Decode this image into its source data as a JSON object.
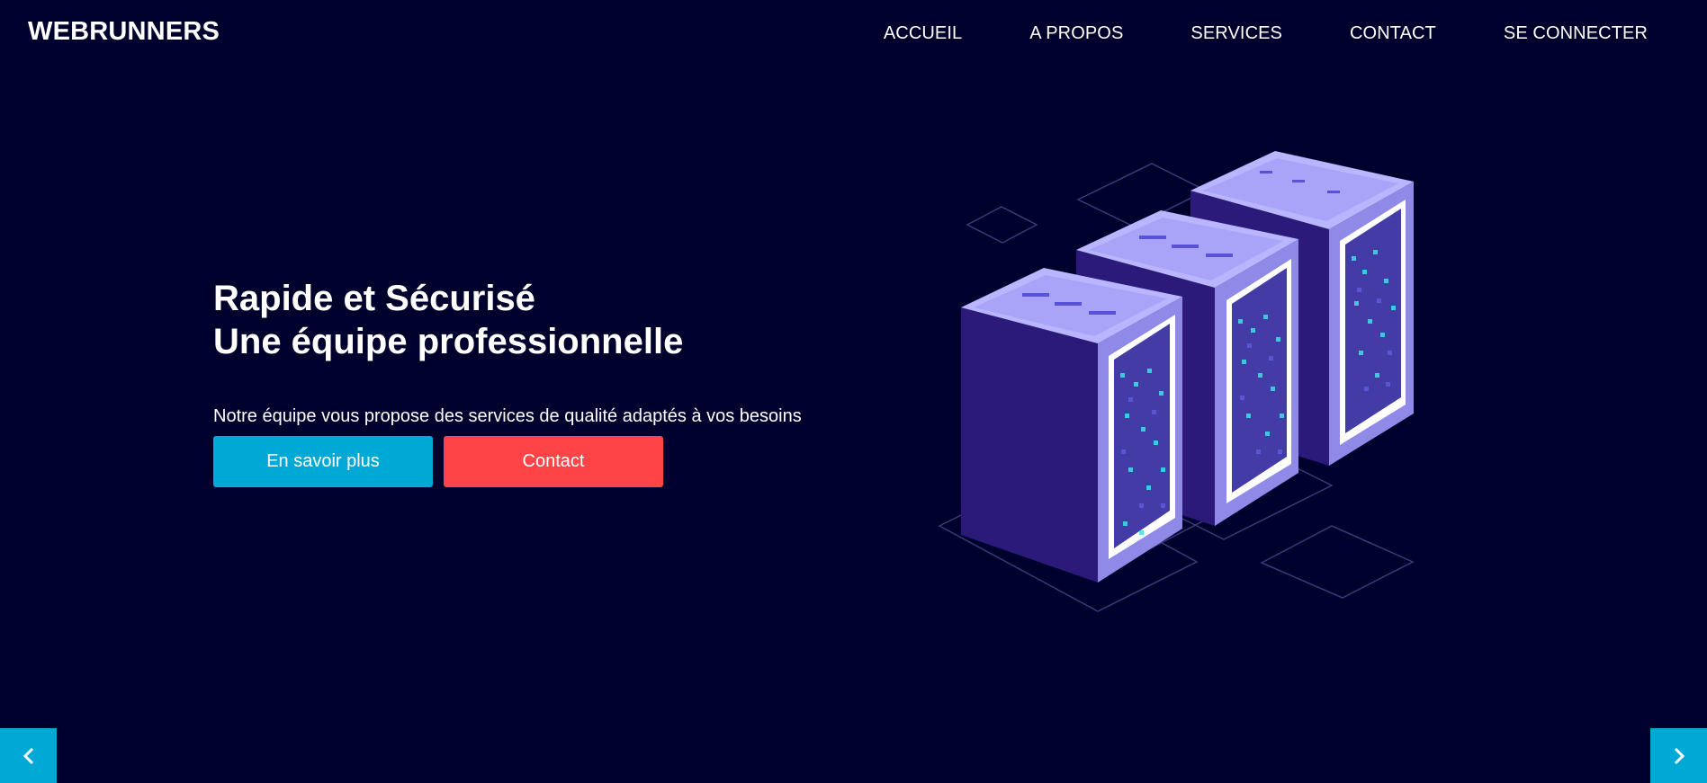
{
  "navbar": {
    "brand": "WEBRUNNERS",
    "links": [
      "ACCUEIL",
      "A PROPOS",
      "SERVICES",
      "CONTACT",
      "SE CONNECTER"
    ]
  },
  "hero": {
    "title_line1": "Rapide et Sécurisé",
    "title_line2": "Une équipe professionnelle",
    "subtitle": "Notre équipe vous propose des services de qualité adaptés à vos besoins",
    "primary_button": "En savoir plus",
    "secondary_button": "Contact"
  },
  "carousel": {
    "prev_icon": "chevron-left-icon",
    "next_icon": "chevron-right-icon"
  },
  "colors": {
    "background": "#00002d",
    "primary": "#00a8d6",
    "secondary": "#ff4447",
    "server_top": "#b9b5ff",
    "server_side": "#2b1a7a",
    "server_front": "#8f8ae8",
    "led": "#3fe0e6"
  }
}
